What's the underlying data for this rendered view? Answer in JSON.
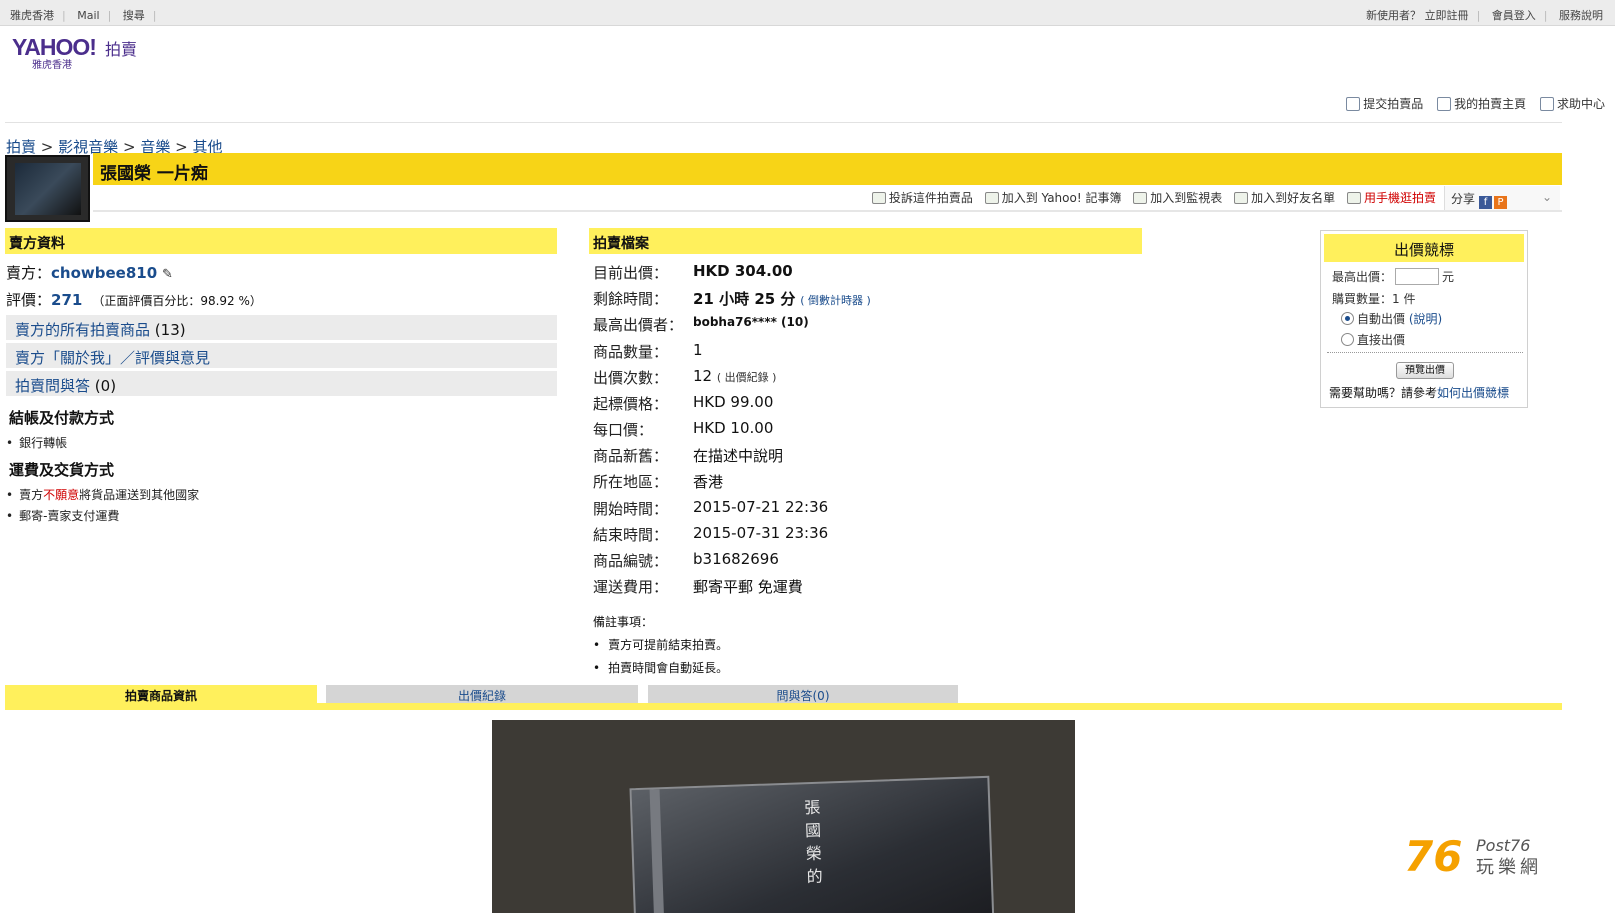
{
  "topbar": {
    "left": [
      "雅虎香港",
      "Mail",
      "搜尋"
    ],
    "new_user": "新使用者？",
    "register": "立即註冊",
    "login": "會員登入",
    "help": "服務說明"
  },
  "logo": {
    "brand": "YAHOO!",
    "sub": "雅虎香港",
    "section": "拍賣"
  },
  "rightnav": [
    "提交拍賣品",
    "我的拍賣主頁",
    "求助中心"
  ],
  "breadcrumb": [
    "拍賣",
    "影視音樂",
    "音樂",
    "其他"
  ],
  "breadcrumb_sep": ">",
  "title": "張國榮 一片痴",
  "toolbar": {
    "report": "投訴這件拍賣品",
    "notebook": "加入到 Yahoo! 記事簿",
    "watch": "加入到監視表",
    "friend": "加入到好友名單",
    "mobile": "用手機逛拍賣",
    "share": "分享"
  },
  "seller": {
    "header": "賣方資料",
    "label": "賣方：",
    "name": "chowbee810",
    "rating_label": "評價：",
    "rating": "271",
    "positive": "（正面評價百分比：98.92 %）",
    "links": [
      {
        "label": "賣方的所有拍賣商品",
        "count": "(13)"
      },
      {
        "label": "賣方「關於我」／評價與意見",
        "count": ""
      },
      {
        "label": "拍賣問與答",
        "count": "(0)"
      }
    ],
    "payment_title": "結帳及付款方式",
    "payment": [
      "銀行轉帳"
    ],
    "shipping_title": "運費及交貨方式",
    "shipping_1a": "賣方",
    "shipping_1b": "不願意",
    "shipping_1c": "將貨品運送到其他國家",
    "shipping_2": "郵寄-賣家支付運費"
  },
  "auction": {
    "header": "拍賣檔案",
    "rows": [
      {
        "label": "目前出價：",
        "value": "HKD 304.00"
      },
      {
        "label": "剩餘時間：",
        "value": "21 小時 25 分",
        "extra": "( 倒數計時器 )"
      },
      {
        "label": "最高出價者：",
        "value": "bobha76**** (10)"
      },
      {
        "label": "商品數量：",
        "value": "1"
      },
      {
        "label": "出價次數：",
        "value": "12",
        "extra": "( 出價紀錄 )"
      },
      {
        "label": "起標價格：",
        "value": "HKD 99.00"
      },
      {
        "label": "每口價：",
        "value": "HKD 10.00"
      },
      {
        "label": "商品新舊：",
        "value": "在描述中說明"
      },
      {
        "label": "所在地區：",
        "value": "香港"
      },
      {
        "label": "開始時間：",
        "value": "2015-07-21 22:36"
      },
      {
        "label": "結束時間：",
        "value": "2015-07-31 23:36"
      },
      {
        "label": "商品編號：",
        "value": "b31682696"
      },
      {
        "label": "運送費用：",
        "value": "郵寄平郵 免運費"
      }
    ],
    "notes_title": "備註事項：",
    "notes": [
      "賣方可提前結束拍賣。",
      "拍賣時間會自動延長。"
    ]
  },
  "bidbox": {
    "title": "出價競標",
    "max_bid_label": "最高出價：",
    "unit": "元",
    "qty": "購買數量：1 件",
    "auto": "自動出價",
    "auto_help": "(說明)",
    "direct": "直接出價",
    "preview": "預覽出價",
    "help_text": "需要幫助嗎？請參考",
    "help_link": "如何出價競標"
  },
  "tabs": [
    "拍賣商品資訊",
    "出價紀錄",
    "問與答(0)"
  ],
  "photo": {
    "cd_text": "張國榮的"
  },
  "watermark": {
    "num": "76",
    "post": "Post76",
    "cn": "玩樂網"
  }
}
